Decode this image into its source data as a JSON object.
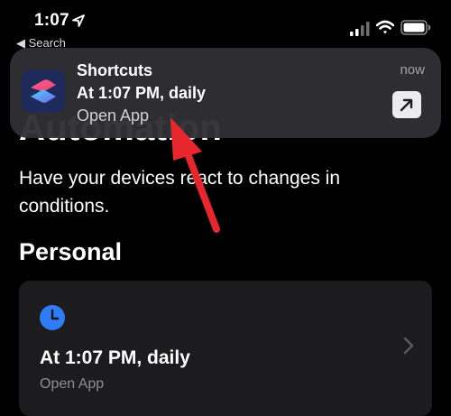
{
  "status_bar": {
    "time": "1:07",
    "back_label": "◀ Search",
    "location_icon": "location-arrow-icon",
    "signal_icon": "cellular-signal-icon",
    "wifi_icon": "wifi-icon",
    "battery_icon": "battery-icon"
  },
  "page": {
    "title": "Automation",
    "description": "Have your devices react to changes in conditions.",
    "section_heading": "Personal"
  },
  "automation_card": {
    "icon": "clock-icon",
    "icon_color": "#2f7cf6",
    "title": "At 1:07 PM, daily",
    "subtitle": "Open App",
    "chevron_icon": "chevron-right-icon"
  },
  "notification": {
    "app_name": "Shortcuts",
    "time": "now",
    "body": "At 1:07 PM, daily",
    "action": "Open App",
    "app_icon": "shortcuts-app-icon",
    "open_icon": "arrow-up-right-icon"
  },
  "annotation": {
    "color": "#e8262d",
    "icon": "red-arrow-annotation"
  }
}
